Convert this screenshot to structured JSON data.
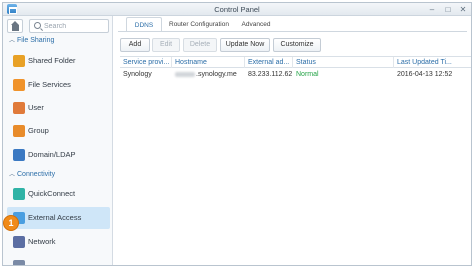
{
  "window": {
    "title": "Control Panel",
    "minimize": "–",
    "maximize": "□",
    "close": "✕"
  },
  "sidebar": {
    "search_placeholder": "Search",
    "sections": [
      {
        "label": "File Sharing"
      },
      {
        "label": "Connectivity"
      }
    ],
    "items": [
      {
        "label": "Shared Folder",
        "color": "#e8a126"
      },
      {
        "label": "File Services",
        "color": "#f0932b"
      },
      {
        "label": "User",
        "color": "#e07a3a"
      },
      {
        "label": "Group",
        "color": "#e88b2a"
      },
      {
        "label": "Domain/LDAP",
        "color": "#3b79c2"
      },
      {
        "label": "QuickConnect",
        "color": "#2fb3a6"
      },
      {
        "label": "External Access",
        "color": "#4a9ee0",
        "active": true
      },
      {
        "label": "Network",
        "color": "#5b6ea3"
      }
    ],
    "badge": "1"
  },
  "tabs": [
    {
      "label": "DDNS",
      "active": true
    },
    {
      "label": "Router Configuration"
    },
    {
      "label": "Advanced"
    }
  ],
  "toolbar": {
    "add": "Add",
    "edit": "Edit",
    "delete": "Delete",
    "update_now": "Update Now",
    "customize": "Customize"
  },
  "table": {
    "columns": [
      "Service provi...",
      "Hostname",
      "External ad...",
      "Status",
      "Last Updated Ti..."
    ],
    "rows": [
      {
        "provider": "Synology",
        "hostname": ".synology.me",
        "external": "83.233.112.62",
        "status": "Normal",
        "updated": "2016-04-13 12:52"
      }
    ]
  },
  "colors": {
    "accent": "#2c6ea8",
    "status_ok": "#23a346",
    "active_bg": "#cfe6f8",
    "badge": "#f08b1a"
  }
}
